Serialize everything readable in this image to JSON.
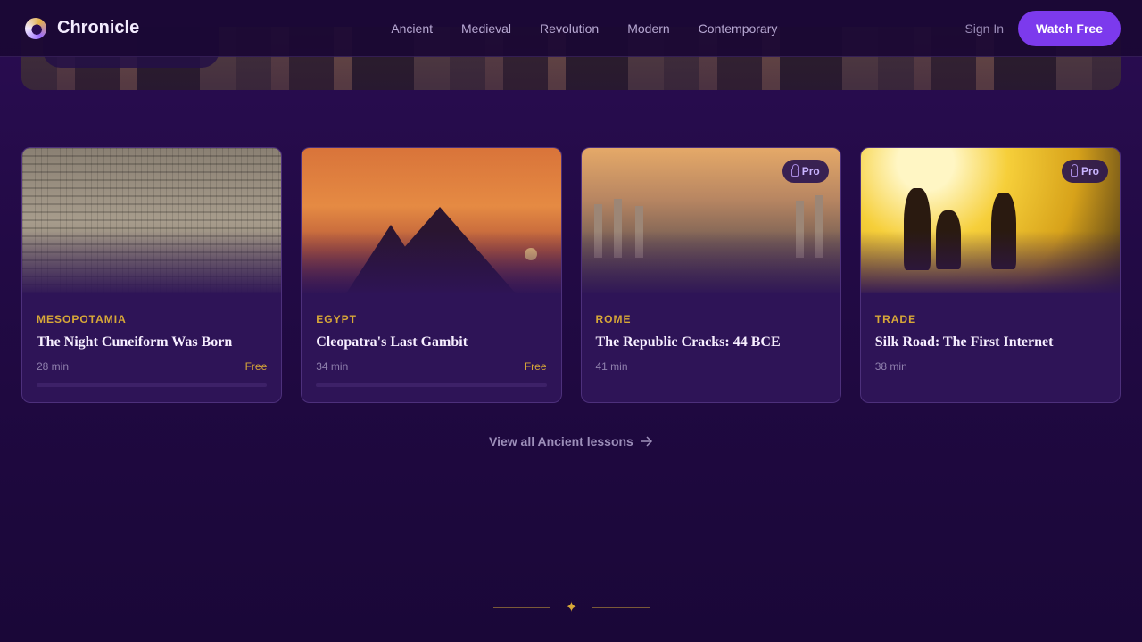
{
  "header": {
    "brand": "Chronicle",
    "nav": [
      "Ancient",
      "Medieval",
      "Revolution",
      "Modern",
      "Contemporary"
    ],
    "sign_in": "Sign In",
    "cta": "Watch Free"
  },
  "cards": [
    {
      "category": "MESOPOTAMIA",
      "title": "The Night Cuneiform Was Born",
      "duration": "28 min",
      "tag": "Free",
      "badge": "",
      "progress": 0
    },
    {
      "category": "EGYPT",
      "title": "Cleopatra's Last Gambit",
      "duration": "34 min",
      "tag": "Free",
      "badge": "",
      "progress": 0
    },
    {
      "category": "ROME",
      "title": "The Republic Cracks: 44 BCE",
      "duration": "41 min",
      "tag": "",
      "badge": "Pro",
      "progress": null
    },
    {
      "category": "TRADE",
      "title": "Silk Road: The First Internet",
      "duration": "38 min",
      "tag": "",
      "badge": "Pro",
      "progress": null
    }
  ],
  "view_all": "View all Ancient lessons",
  "icons": {
    "logo": "chronicle-logo-icon",
    "lock": "lock-icon",
    "arrow": "arrow-right-icon",
    "divider": "sparkle-icon"
  },
  "colors": {
    "accent": "#7c3aed",
    "gold": "#d8a838",
    "background": "#220a45"
  }
}
